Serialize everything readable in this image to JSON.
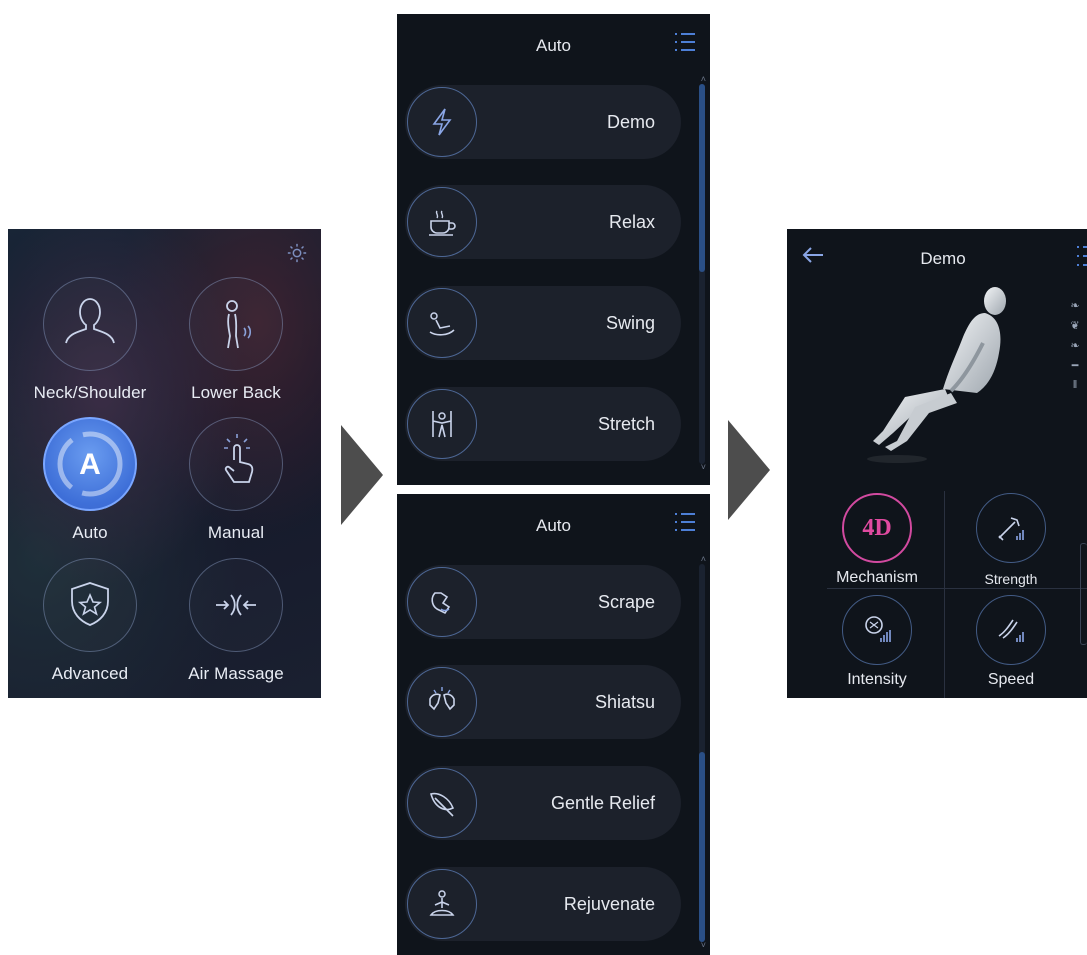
{
  "home": {
    "tiles": [
      {
        "label": "Neck/Shoulder",
        "icon": "head-shoulder-icon"
      },
      {
        "label": "Lower Back",
        "icon": "lower-back-icon"
      },
      {
        "label": "Auto",
        "icon": "auto-a-icon",
        "active": true,
        "glyph": "A"
      },
      {
        "label": "Manual",
        "icon": "hand-touch-icon"
      },
      {
        "label": "Advanced",
        "icon": "shield-star-icon"
      },
      {
        "label": "Air Massage",
        "icon": "air-arrows-icon"
      }
    ],
    "settings_icon": "gear-icon"
  },
  "list1": {
    "title": "Auto",
    "items": [
      {
        "label": "Demo",
        "icon": "lightning-icon"
      },
      {
        "label": "Relax",
        "icon": "coffee-cup-icon"
      },
      {
        "label": "Swing",
        "icon": "swing-icon"
      },
      {
        "label": "Stretch",
        "icon": "stretch-icon"
      }
    ]
  },
  "list2": {
    "title": "Auto",
    "items": [
      {
        "label": "Scrape",
        "icon": "scrape-hand-icon"
      },
      {
        "label": "Shiatsu",
        "icon": "shiatsu-hands-icon"
      },
      {
        "label": "Gentle Relief",
        "icon": "feather-icon"
      },
      {
        "label": "Rejuvenate",
        "icon": "meditation-icon"
      }
    ]
  },
  "demo": {
    "title": "Demo",
    "controls": [
      {
        "label": "Mechanism",
        "badge": "4D"
      },
      {
        "label": "Strength",
        "icon": "strength-icon"
      },
      {
        "label": "Intensity",
        "icon": "intensity-icon"
      },
      {
        "label": "Speed",
        "icon": "speed-icon"
      }
    ]
  },
  "colors": {
    "accent": "#3e6fd8",
    "badge": "#d24aa0",
    "panel": "#0f141b"
  }
}
